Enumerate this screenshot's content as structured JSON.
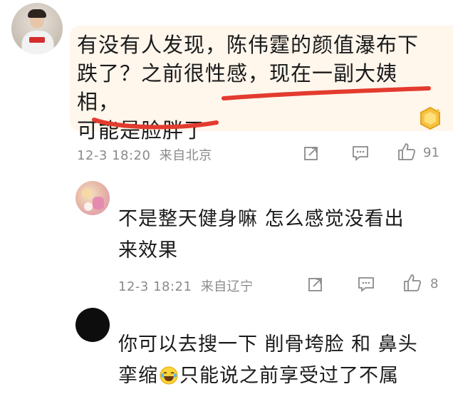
{
  "comments": [
    {
      "text_line1": "有没有人发现，陈伟霆的颜值瀑布下",
      "text_line2": "跌了？之前很性感，现在一副大姨相，",
      "text_line3": "可能是脸胖了",
      "time": "12-3 18:20",
      "location": "来自北京",
      "likes": "91",
      "highlight_color": "#e33b2e",
      "bubble_color": "#fff6ec"
    },
    {
      "text_line1": "不是整天健身嘛 怎么感觉没看出",
      "text_line2": "来效果",
      "time": "12-3 18:21",
      "location": "来自辽宁",
      "likes": "8"
    },
    {
      "text_line1": "你可以去搜一下 削骨垮脸 和 鼻头",
      "text_line2_a": "挛缩",
      "text_line2_b": "只能说之前享受过了不属",
      "emoji": "laugh-cry-emoji"
    }
  ],
  "icons": {
    "share": "share-icon",
    "comment": "comment-icon",
    "like": "thumbs-up-icon",
    "badge": "gold-gem-badge-icon"
  }
}
